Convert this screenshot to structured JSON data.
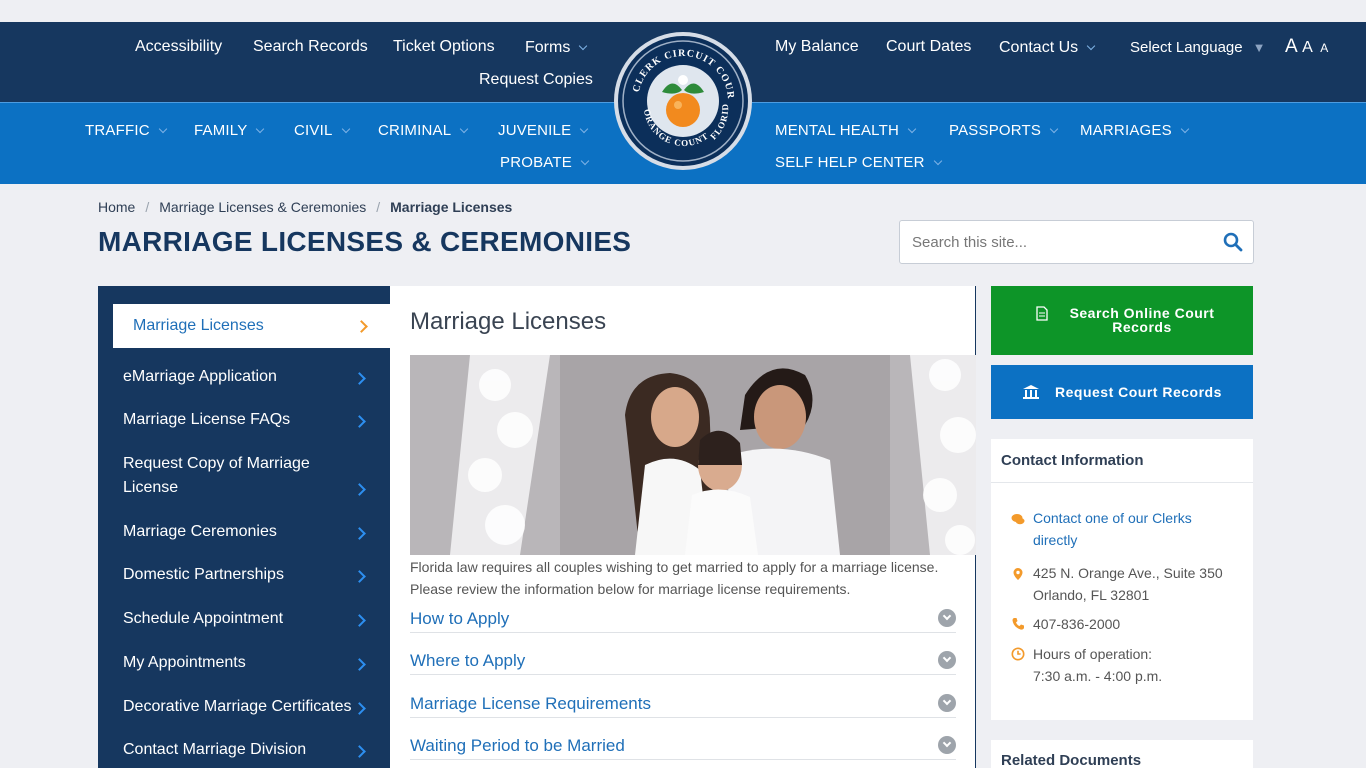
{
  "top_nav": {
    "accessibility": "Accessibility",
    "search_records": "Search Records",
    "ticket_options": "Ticket Options",
    "forms": "Forms",
    "request_copies": "Request Copies",
    "my_balance": "My Balance",
    "court_dates": "Court Dates",
    "contact_us": "Contact Us",
    "select_language": "Select Language",
    "font_sizes": [
      "A",
      "A",
      "A"
    ]
  },
  "seal": {
    "top_text": "CLERK CIRCUIT COURT",
    "bottom_text": "ORANGE COUNTY",
    "right_text": "FLORIDA"
  },
  "category_nav": {
    "traffic": "TRAFFIC",
    "family": "FAMILY",
    "civil": "CIVIL",
    "criminal": "CRIMINAL",
    "juvenile": "JUVENILE",
    "probate": "PROBATE",
    "mental_health": "MENTAL HEALTH",
    "passports": "PASSPORTS",
    "marriages": "MARRIAGES",
    "self_help": "SELF HELP CENTER"
  },
  "breadcrumb": {
    "home": "Home",
    "parent": "Marriage Licenses & Ceremonies",
    "current": "Marriage Licenses"
  },
  "page_title": "MARRIAGE LICENSES & CEREMONIES",
  "search": {
    "placeholder": "Search this site..."
  },
  "sidebar": {
    "active": "Marriage Licenses",
    "items": [
      "eMarriage Application",
      "Marriage License FAQs",
      "Request Copy of Marriage License",
      "Marriage Ceremonies",
      "Domestic Partnerships",
      "Schedule Appointment",
      "My Appointments",
      "Decorative Marriage Certificates",
      "Contact Marriage Division"
    ]
  },
  "main": {
    "heading": "Marriage Licenses",
    "intro": "Florida law requires all couples wishing to get married to apply for a marriage license. Please review the information below for marriage license requirements.",
    "accordion": [
      "How to Apply",
      "Where to Apply",
      "Marriage License Requirements",
      "Waiting Period to be Married"
    ]
  },
  "right": {
    "btn_search": "Search Online Court Records",
    "btn_request": "Request Court Records",
    "contact_title": "Contact Information",
    "contact_link": "Contact one of our Clerks directly",
    "address1": "425 N. Orange Ave., Suite 350",
    "address2": "Orlando, FL 32801",
    "phone": "407-836-2000",
    "hours_label": "Hours of operation:",
    "hours": "7:30 a.m. - 4:00 p.m.",
    "related_title": "Related Documents"
  },
  "colors": {
    "navy": "#16375f",
    "blue": "#0c71c3",
    "green": "#0d9528",
    "accent_orange": "#f39a2b",
    "link": "#1f6fb8"
  }
}
